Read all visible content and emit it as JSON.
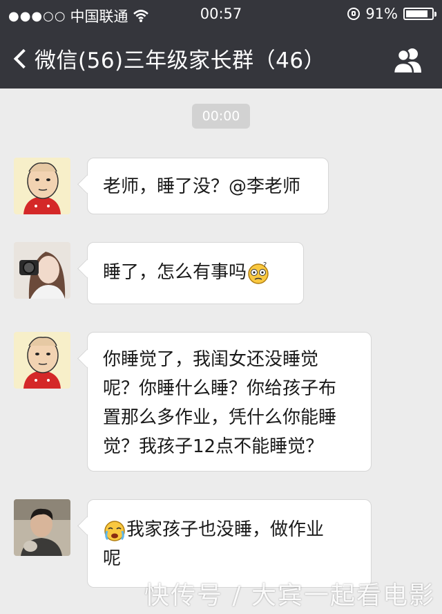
{
  "status_bar": {
    "signal": "●●●○○",
    "carrier": "中国联通",
    "time": "00:57",
    "battery_percent": "91%",
    "battery_level": 0.91
  },
  "nav": {
    "back_label": "微信(56)",
    "title": "三年级家长群（46）",
    "group_icon": "group-members-icon"
  },
  "chat": {
    "timestamp": "00:00",
    "messages": [
      {
        "text": "老师，睡了没？@李老师"
      },
      {
        "text": "睡了，怎么有事吗",
        "emoji": "confused-face-emoji"
      },
      {
        "lines": [
          "你睡觉了，我闺女还没睡觉",
          "呢？你睡什么睡？你给孩子布",
          "置那么多作业，凭什么你能睡",
          "觉？我孩子12点不能睡觉？"
        ]
      },
      {
        "lines": [
          "我家孩子也没睡，做作业",
          "呢"
        ],
        "emoji": "crying-face-emoji"
      }
    ]
  },
  "watermark": "快传号 / 大宾一起看电影",
  "colors": {
    "bar": "#35363c",
    "background": "#ececec",
    "bubble": "#ffffff"
  }
}
